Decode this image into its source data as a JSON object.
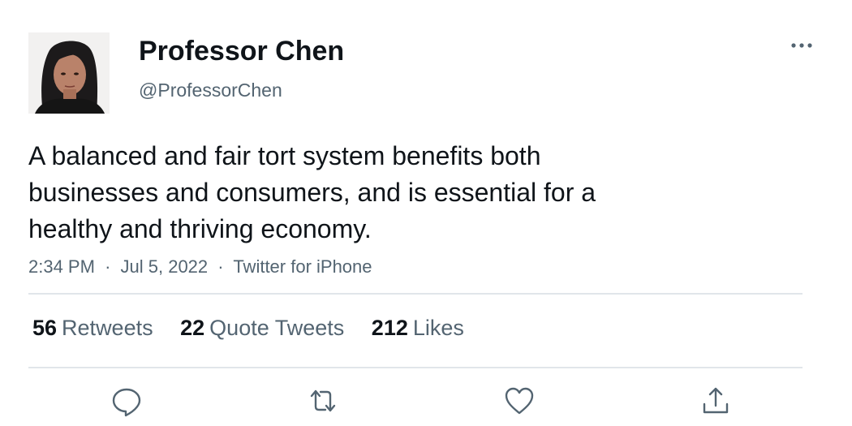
{
  "user": {
    "display_name": "Professor Chen",
    "handle": "@ProfessorChen",
    "avatar_icon": "profile-photo"
  },
  "tweet": {
    "text_lines": [
      "A balanced and fair tort system benefits both",
      "businesses and consumers, and is essential for a",
      "healthy and thriving economy."
    ],
    "time": "2:34 PM",
    "date": "Jul 5, 2022",
    "source": "Twitter for iPhone",
    "separator": "·"
  },
  "stats": {
    "retweets": {
      "count": "56",
      "label": "Retweets"
    },
    "quotes": {
      "count": "22",
      "label": "Quote Tweets"
    },
    "likes": {
      "count": "212",
      "label": "Likes"
    }
  },
  "actions": {
    "icons": [
      "reply-icon",
      "retweet-icon",
      "like-icon",
      "share-icon"
    ]
  },
  "colors": {
    "text": "#0f1419",
    "secondary": "#536471",
    "divider": "#e1e6ea"
  }
}
